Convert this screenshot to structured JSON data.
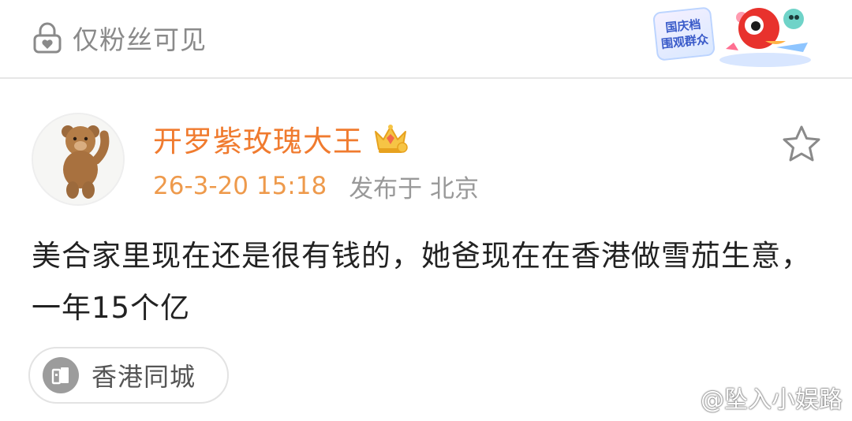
{
  "header": {
    "visibility_label": "仅粉丝可见",
    "badge_line1": "国庆档",
    "badge_line2": "围观群众"
  },
  "post": {
    "username": "开罗紫玫瑰大王",
    "timestamp": "26-3-20 15:18",
    "location": "发布于 北京",
    "text": "美合家里现在还是很有钱的，她爸现在在香港做雪茄生意，一年15个亿",
    "group_chip": "香港同城"
  },
  "watermark": {
    "handle": "@坠入小娱路"
  },
  "icons": {
    "visibility": "lock-icon",
    "member": "crown-icon",
    "favorite": "star-icon",
    "group": "group-building-icon",
    "weibo": "weibo-logo-icon"
  },
  "colors": {
    "username": "#f07b2f",
    "timestamp": "#ee9a4c",
    "muted": "#999999",
    "body_text": "#222222"
  }
}
